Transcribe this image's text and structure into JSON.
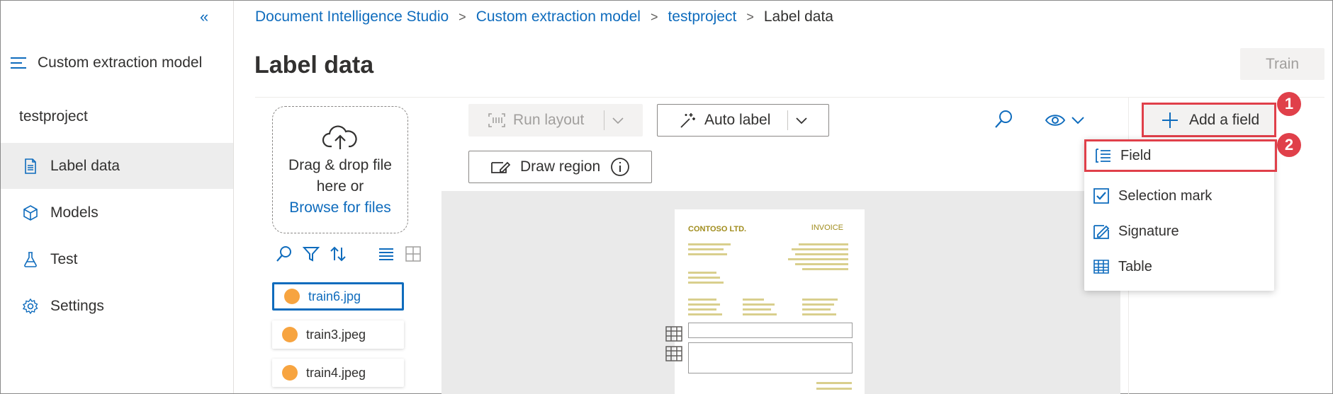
{
  "sidebar": {
    "collapse_glyph": "«",
    "model_label": "Custom extraction model",
    "project": "testproject",
    "items": [
      {
        "label": "Label data",
        "icon": "document-icon"
      },
      {
        "label": "Models",
        "icon": "cube-icon"
      },
      {
        "label": "Test",
        "icon": "flask-icon"
      },
      {
        "label": "Settings",
        "icon": "gear-icon"
      }
    ]
  },
  "breadcrumb": [
    "Document Intelligence Studio",
    "Custom extraction model",
    "testproject",
    "Label data"
  ],
  "page_title": "Label data",
  "train_label": "Train",
  "upload": {
    "line1": "Drag & drop file",
    "line2": "here or",
    "browse": "Browse for files"
  },
  "files": [
    {
      "name": "train6.jpg"
    },
    {
      "name": "train3.jpeg"
    },
    {
      "name": "train4.jpeg"
    }
  ],
  "toolbar": {
    "run_layout": "Run layout",
    "auto_label": "Auto label",
    "draw_region": "Draw region"
  },
  "add_field_label": "Add a field",
  "badges": [
    "1",
    "2"
  ],
  "menu": [
    {
      "label": "Field",
      "icon": "list-icon"
    },
    {
      "label": "Selection mark",
      "icon": "checkbox-icon"
    },
    {
      "label": "Signature",
      "icon": "signature-icon"
    },
    {
      "label": "Table",
      "icon": "table-icon"
    }
  ],
  "invoice": {
    "company": "CONTOSO LTD.",
    "doc_title": "INVOICE"
  },
  "colors": {
    "accent": "#0f6cbd",
    "highlight": "#e0404a",
    "file_dot": "#f7a440"
  }
}
